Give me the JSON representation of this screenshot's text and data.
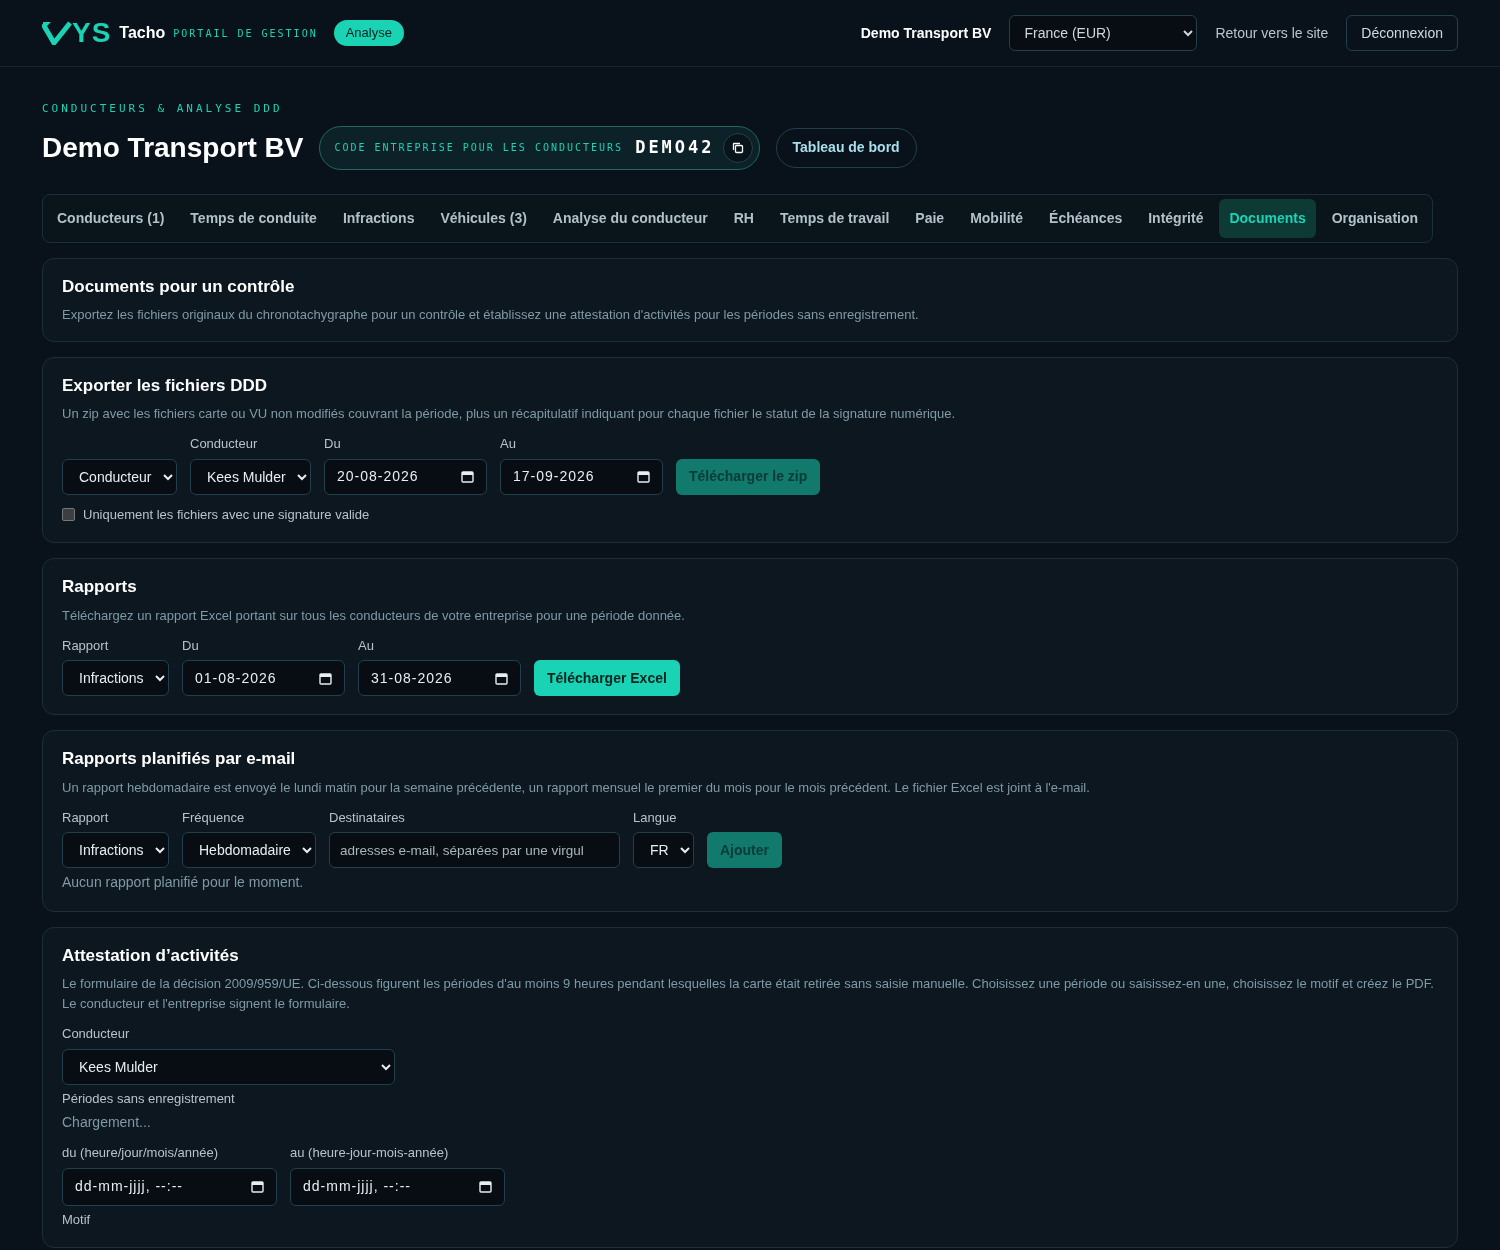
{
  "header": {
    "logo_text": "YS",
    "brand": "Tacho",
    "subtitle": "PORTAIL DE GESTION",
    "badge": "Analyse",
    "company": "Demo Transport BV",
    "currency": "France (EUR)",
    "link": "Retour vers le site",
    "logout": "Déconnexion"
  },
  "page": {
    "eyebrow": "CONDUCTEURS & ANALYSE DDD",
    "title": "Demo Transport BV",
    "code_label": "CODE ENTREPRISE POUR LES CONDUCTEURS",
    "code": "DEMO42",
    "dashboard": "Tableau de bord"
  },
  "tabs": [
    {
      "label": "Conducteurs (1)",
      "selected": false
    },
    {
      "label": "Temps de conduite",
      "selected": false
    },
    {
      "label": "Infractions",
      "selected": false
    },
    {
      "label": "Véhicules (3)",
      "selected": false
    },
    {
      "label": "Analyse du conducteur",
      "selected": false
    },
    {
      "label": "RH",
      "selected": false
    },
    {
      "label": "Temps de travail",
      "selected": false
    },
    {
      "label": "Paie",
      "selected": false
    },
    {
      "label": "Mobilité",
      "selected": false
    },
    {
      "label": "Échéances",
      "selected": false
    },
    {
      "label": "Intégrité",
      "selected": false
    },
    {
      "label": "Documents",
      "selected": true
    },
    {
      "label": "Organisation",
      "selected": false
    }
  ],
  "sections": [
    {
      "title": "Documents pour un contrôle",
      "description": "Exportez les fichiers originaux du chronotachygraphe pour un contrôle et établissez une attestation d'activités pour les périodes sans enregistrement."
    },
    {
      "title": "Exporter les fichiers DDD",
      "description": "Un zip avec les fichiers carte ou VU non modifiés couvrant la période, plus un récapitulatif indiquant pour chaque fichier le statut de la signature numérique.",
      "rows": [
        [
          {
            "kind": "select",
            "value": "Conducteur"
          },
          {
            "kind": "select",
            "label": "Conducteur",
            "value": "Kees Mulder"
          },
          {
            "kind": "date",
            "label": "Du",
            "value": "20-08-2026"
          },
          {
            "kind": "date",
            "label": "Au",
            "value": "17-09-2026"
          },
          {
            "kind": "button",
            "value": "Télécharger le zip",
            "disabled": true
          }
        ],
        [
          {
            "kind": "checkbox",
            "value": "Uniquement les fichiers avec une signature valide",
            "checked": false
          }
        ]
      ]
    },
    {
      "title": "Rapports",
      "description": "Téléchargez un rapport Excel portant sur tous les conducteurs de votre entreprise pour une période donnée.",
      "rows": [
        [
          {
            "kind": "select",
            "label": "Rapport",
            "value": "Infractions"
          },
          {
            "kind": "date",
            "label": "Du",
            "value": "01-08-2026"
          },
          {
            "kind": "date",
            "label": "Au",
            "value": "31-08-2026"
          },
          {
            "kind": "button",
            "value": "Télécharger Excel",
            "disabled": false
          }
        ]
      ]
    },
    {
      "title": "Rapports planifiés par e-mail",
      "description": "Un rapport hebdomadaire est envoyé le lundi matin pour la semaine précédente, un rapport mensuel le premier du mois pour le mois précédent. Le fichier Excel est joint à l'e-mail.",
      "rows": [
        [
          {
            "kind": "select",
            "label": "Rapport",
            "value": "Infractions"
          },
          {
            "kind": "select",
            "label": "Fréquence",
            "value": "Hebdomadaire"
          },
          {
            "kind": "text",
            "label": "Destinataires",
            "placeholder": "adresses e-mail, séparées par une virgul"
          },
          {
            "kind": "select",
            "label": "Langue",
            "value": "FR"
          },
          {
            "kind": "button",
            "value": "Ajouter",
            "disabled": true
          }
        ],
        [
          {
            "kind": "note",
            "value": "Aucun rapport planifié pour le moment."
          }
        ]
      ]
    },
    {
      "title": "Attestation d’activités",
      "description": "Le formulaire de la décision 2009/959/UE. Ci-dessous figurent les périodes d'au moins 9 heures pendant lesquelles la carte était retirée sans saisie manuelle. Choisissez une période ou saisissez-en une, choisissez le motif et créez le PDF. Le conducteur et l'entreprise signent le formulaire.",
      "rows": [
        [
          {
            "kind": "select",
            "label": "Conducteur",
            "value": "Kees Mulder",
            "wide": true
          }
        ],
        [
          {
            "kind": "caption",
            "value": "Périodes sans enregistrement"
          }
        ],
        [
          {
            "kind": "note",
            "value": "Chargement..."
          }
        ],
        [
          {
            "kind": "datetime",
            "label": "du (heure/jour/mois/année)",
            "value": "dd-mm-jjjj, --:--"
          },
          {
            "kind": "datetime",
            "label": "au (heure-jour-mois-année)",
            "value": "dd-mm-jjjj, --:--"
          }
        ],
        [
          {
            "kind": "caption",
            "value": "Motif"
          }
        ]
      ]
    }
  ]
}
